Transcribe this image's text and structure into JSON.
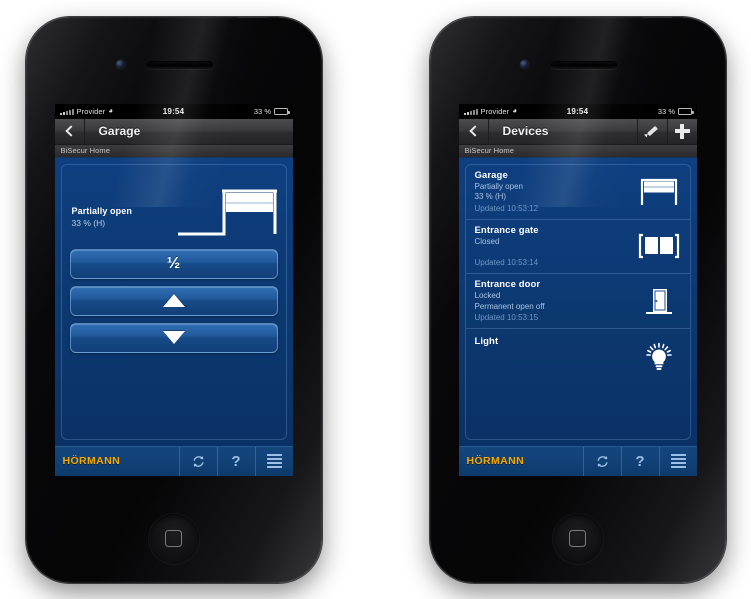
{
  "meta": {
    "brand": "HÖRMANN",
    "accent_blue": "#0d3b79",
    "accent_orange": "#f5a800"
  },
  "status_bar": {
    "carrier": "Provider",
    "wifi_icon": "wifi-icon",
    "time": "19:54",
    "battery_percent": "33 %",
    "battery_icon": "battery-icon"
  },
  "phones": [
    {
      "id": "phone-left",
      "screen": "garage-control",
      "navbar": {
        "back_icon": "chevron-left-icon",
        "title": "Garage",
        "actions": []
      },
      "subbar": {
        "label": "BiSecur Home"
      },
      "control": {
        "status_main": "Partially open",
        "status_sub": "33 % (H)",
        "door_icon": "garage-door-partially-open-icon",
        "buttons": [
          {
            "name": "half-open-button",
            "label": "½",
            "icon": "half-fraction"
          },
          {
            "name": "open-up-button",
            "label": "",
            "icon": "triangle-up-icon"
          },
          {
            "name": "close-down-button",
            "label": "",
            "icon": "triangle-down-icon"
          }
        ]
      },
      "toolbar": {
        "brand": "HÖRMANN",
        "buttons": [
          {
            "name": "refresh-button",
            "icon": "refresh-icon",
            "label": ""
          },
          {
            "name": "help-button",
            "icon": "question-mark-icon",
            "label": "?"
          },
          {
            "name": "menu-button",
            "icon": "hamburger-menu-icon",
            "label": ""
          }
        ]
      }
    },
    {
      "id": "phone-right",
      "screen": "device-list",
      "navbar": {
        "back_icon": "chevron-left-icon",
        "title": "Devices",
        "actions": [
          {
            "name": "edit-button",
            "icon": "pencil-icon"
          },
          {
            "name": "add-device-button",
            "icon": "plus-icon"
          }
        ]
      },
      "subbar": {
        "label": "BiSecur Home"
      },
      "devices": [
        {
          "name": "Garage",
          "state": "Partially open",
          "detail": "33 % (H)",
          "updated": "Updated 10:53:12",
          "icon": "garage-door-partially-open-icon"
        },
        {
          "name": "Entrance gate",
          "state": "Closed",
          "detail": "",
          "updated": "Updated 10:53:14",
          "icon": "double-gate-closed-icon"
        },
        {
          "name": "Entrance door",
          "state": "Locked",
          "detail": "Permanent open off",
          "updated": "Updated 10:53:15",
          "icon": "door-icon"
        },
        {
          "name": "Light",
          "state": "",
          "detail": "",
          "updated": "",
          "icon": "light-bulb-icon"
        }
      ],
      "toolbar": {
        "brand": "HÖRMANN",
        "buttons": [
          {
            "name": "refresh-button",
            "icon": "refresh-icon",
            "label": ""
          },
          {
            "name": "help-button",
            "icon": "question-mark-icon",
            "label": "?"
          },
          {
            "name": "menu-button",
            "icon": "hamburger-menu-icon",
            "label": ""
          }
        ]
      }
    }
  ]
}
